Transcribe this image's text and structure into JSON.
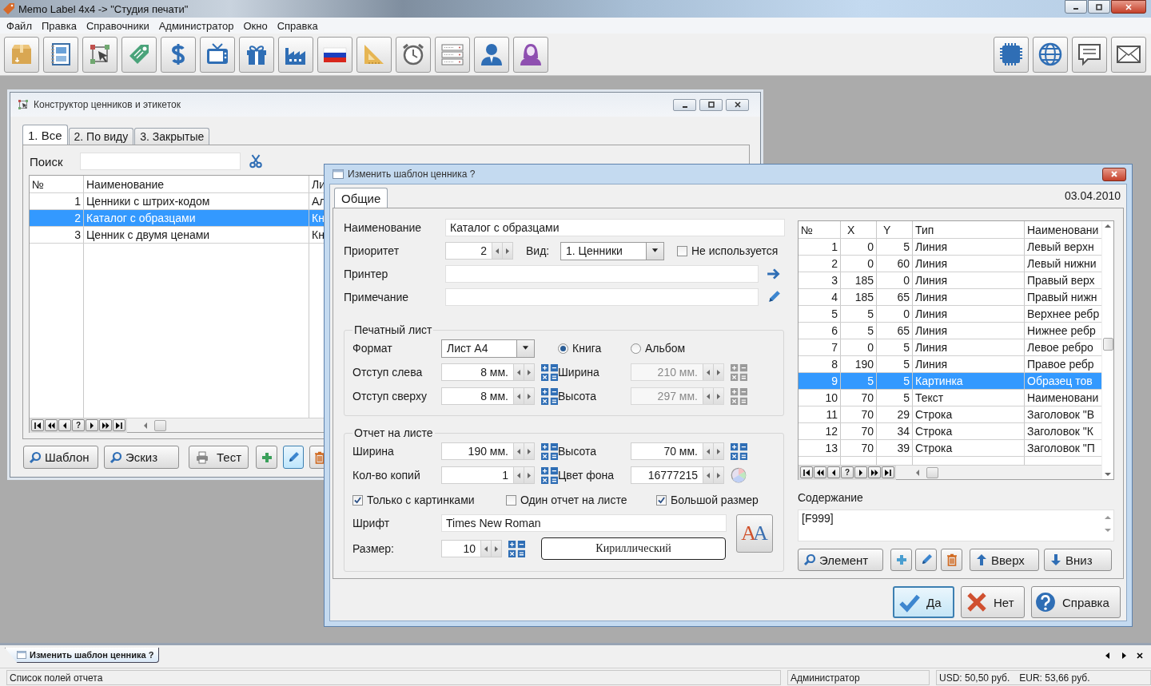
{
  "app": {
    "title": "Memo Label 4x4 -> \"Студия печати\""
  },
  "menu": [
    "Файл",
    "Правка",
    "Справочники",
    "Администратор",
    "Окно",
    "Справка"
  ],
  "catalog_window": {
    "title": "Конструктор ценников и этикеток",
    "tabs": [
      {
        "label": "1. Все",
        "selected": true
      },
      {
        "label": "2. По виду",
        "selected": false
      },
      {
        "label": "3. Закрытые",
        "selected": false
      }
    ],
    "search_label": "Поиск",
    "table": {
      "columns": [
        "№",
        "Наименование",
        "Ли"
      ],
      "rows": [
        {
          "cells": [
            "1",
            "Ценники с штрих-кодом",
            "Ал"
          ],
          "selected": false
        },
        {
          "cells": [
            "2",
            "Каталог с образцами",
            "Кн"
          ],
          "selected": true
        },
        {
          "cells": [
            "3",
            "Ценник с двумя ценами",
            "Кн"
          ],
          "selected": false
        }
      ]
    },
    "navigator_help": "?",
    "buttons": [
      {
        "kind": "search",
        "label": "Шаблон",
        "focused": false
      },
      {
        "kind": "search",
        "label": "Эскиз",
        "focused": false
      },
      {
        "kind": "print",
        "label": "Тест",
        "focused": false
      },
      {
        "kind": "add",
        "focused": false
      },
      {
        "kind": "edit",
        "focused": true
      },
      {
        "kind": "delete",
        "focused": false
      }
    ]
  },
  "dialog": {
    "title": "Изменить шаблон ценника ?",
    "tabs": [
      {
        "label": "Общие",
        "selected": true
      }
    ],
    "date": "03.04.2010",
    "name": {
      "label": "Наименование",
      "value": "Каталог с образцами"
    },
    "priority": {
      "label": "Приоритет",
      "value": "2"
    },
    "type_select": {
      "label": "Вид:",
      "value": "1. Ценники"
    },
    "unused": {
      "label": "Не используется",
      "checked": false
    },
    "printer": {
      "label": "Принтер"
    },
    "note": {
      "label": "Примечание"
    },
    "print_sheet": {
      "title": "Печатный лист",
      "format": {
        "label": "Формат",
        "value": "Лист А4"
      },
      "orientation": [
        {
          "label": "Книга",
          "selected": true
        },
        {
          "label": "Альбом",
          "selected": false
        }
      ],
      "fields": [
        {
          "label": "Отступ слева",
          "value": "8 мм.",
          "disabled": false,
          "kind": "spin"
        },
        {
          "label": "Ширина",
          "value": "210 мм.",
          "disabled": true,
          "kind": "spin"
        },
        {
          "label": "Отступ сверху",
          "value": "8 мм.",
          "disabled": false,
          "kind": "spin"
        },
        {
          "label": "Высота",
          "value": "297 мм.",
          "disabled": true,
          "kind": "spin"
        }
      ]
    },
    "report": {
      "title": "Отчет на листе",
      "fields": [
        {
          "label": "Ширина",
          "value": "190 мм.",
          "disabled": false,
          "kind": "spin"
        },
        {
          "label": "Высота",
          "value": "70 мм.",
          "disabled": false,
          "kind": "spin"
        },
        {
          "label": "Кол-во копий",
          "value": "1",
          "disabled": false,
          "kind": "spin"
        },
        {
          "label": "Цвет фона",
          "value": "16777215",
          "disabled": false,
          "kind": "color"
        }
      ],
      "options": [
        {
          "label": "Только с картинками",
          "checked": true
        },
        {
          "label": "Один отчет на листе",
          "checked": false
        },
        {
          "label": "Большой размер",
          "checked": true
        }
      ],
      "font": {
        "label": "Шрифт",
        "value": "Times New Roman"
      },
      "size": {
        "label": "Размер:",
        "value": "10"
      },
      "charset": "Кириллический",
      "font_button": "AA"
    },
    "elements": {
      "columns": [
        "№",
        "X",
        "Y",
        "Тип",
        "Наименовани"
      ],
      "rows": [
        {
          "cells": [
            "1",
            "0",
            "5",
            "Линия",
            "Левый верхн"
          ],
          "selected": false
        },
        {
          "cells": [
            "2",
            "0",
            "60",
            "Линия",
            "Левый нижни"
          ],
          "selected": false
        },
        {
          "cells": [
            "3",
            "185",
            "0",
            "Линия",
            "Правый верх"
          ],
          "selected": false
        },
        {
          "cells": [
            "4",
            "185",
            "65",
            "Линия",
            "Правый нижн"
          ],
          "selected": false
        },
        {
          "cells": [
            "5",
            "5",
            "0",
            "Линия",
            "Верхнее ребр"
          ],
          "selected": false
        },
        {
          "cells": [
            "6",
            "5",
            "65",
            "Линия",
            "Нижнее ребр"
          ],
          "selected": false
        },
        {
          "cells": [
            "7",
            "0",
            "5",
            "Линия",
            "Левое ребро"
          ],
          "selected": false
        },
        {
          "cells": [
            "8",
            "190",
            "5",
            "Линия",
            "Правое ребр"
          ],
          "selected": false
        },
        {
          "cells": [
            "9",
            "5",
            "5",
            "Картинка",
            "Образец тов"
          ],
          "selected": true
        },
        {
          "cells": [
            "10",
            "70",
            "5",
            "Текст",
            "Наименовани"
          ],
          "selected": false
        },
        {
          "cells": [
            "11",
            "70",
            "29",
            "Строка",
            "Заголовок \"В"
          ],
          "selected": false
        },
        {
          "cells": [
            "12",
            "70",
            "34",
            "Строка",
            "Заголовок \"К"
          ],
          "selected": false
        },
        {
          "cells": [
            "13",
            "70",
            "39",
            "Строка",
            "Заголовок \"П"
          ],
          "selected": false
        }
      ]
    },
    "navigator_help": "?",
    "content": {
      "label": "Содержание",
      "value": "[F999]"
    },
    "element_buttons": [
      {
        "kind": "search",
        "label": "Элемент"
      },
      {
        "kind": "add"
      },
      {
        "kind": "edit"
      },
      {
        "kind": "delete"
      },
      {
        "kind": "up",
        "label": "Вверх"
      },
      {
        "kind": "down",
        "label": "Вниз"
      }
    ],
    "footer_buttons": [
      {
        "kind": "ok",
        "label": "Да",
        "focused": true
      },
      {
        "kind": "cancel",
        "label": "Нет",
        "focused": false
      },
      {
        "kind": "help",
        "label": "Справка",
        "focused": false
      }
    ]
  },
  "taskbar": {
    "tabs": [
      {
        "label": "Изменить шаблон ценника ?",
        "selected": true
      }
    ]
  },
  "status_bar": {
    "message": "Список полей отчета",
    "user": "Администратор",
    "rates": [
      "USD: 50,50 руб.",
      "EUR: 53,66 руб."
    ]
  }
}
